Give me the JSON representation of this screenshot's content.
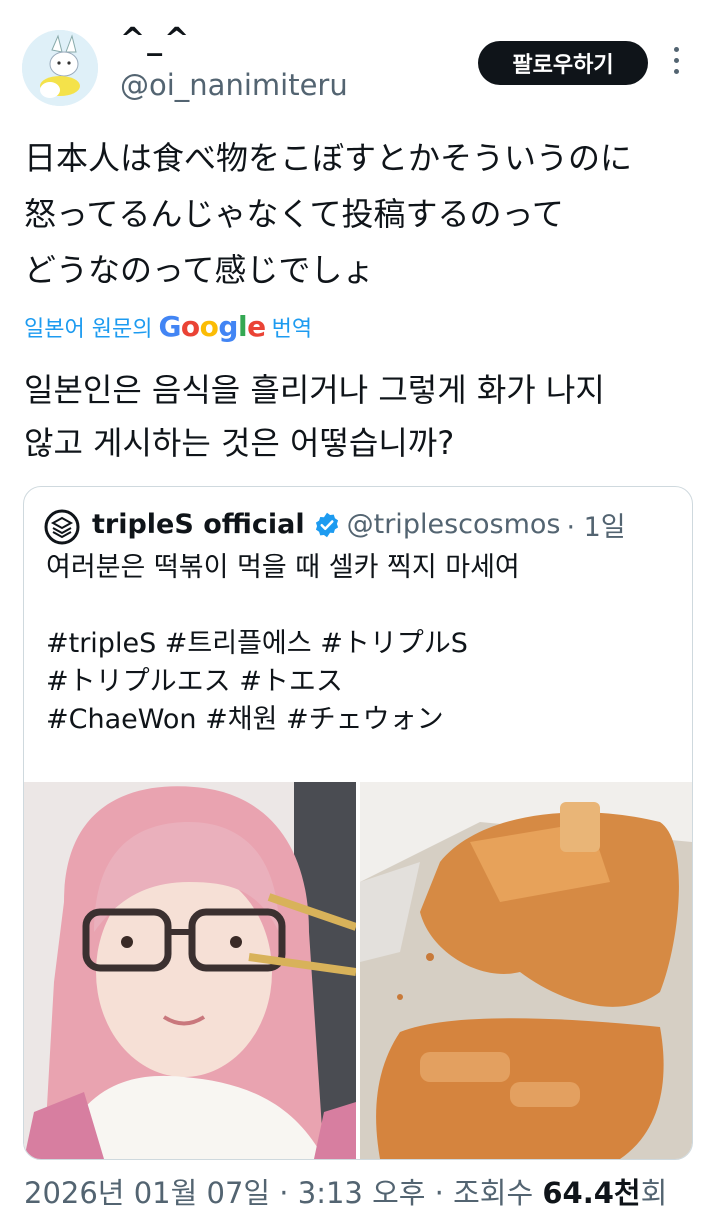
{
  "author": {
    "display_name": "^_^",
    "handle": "@oi_nanimiteru",
    "avatar_icon": "fox-avatar-icon"
  },
  "follow_label": "팔로우하기",
  "more_icon": "more-vertical-icon",
  "tweet_lines": [
    "日本人は食べ物をこぼすとかそういうのに",
    "怒ってるんじゃなくて投稿するのって",
    "どうなのって感じでしょ"
  ],
  "translation": {
    "prefix": "일본어 원문의",
    "google": "Google",
    "suffix": "번역",
    "lines": [
      "일본인은 음식을 흘리거나 그렇게 화가 나지",
      "않고 게시하는 것은 어떻습니까?"
    ]
  },
  "quote": {
    "name": "tripleS official",
    "handle": "@triplescosmos",
    "time": "· 1일",
    "verified_icon": "verified-badge-icon",
    "lines": [
      "여러분은 떡볶이 먹을 때 셀카 찍지 마세여",
      "",
      "#tripleS #트리플에스 #トリプルS",
      "#トリプルエス #トエス",
      "#ChaeWon #채원 #チェウォン"
    ]
  },
  "footer": {
    "date": "2026년 01월 07일 · 3:13 오후 · 조회수",
    "views": "64.4천",
    "views_suffix": "회"
  },
  "colors": {
    "accent": "#1d9bf0",
    "text": "#0f1419",
    "muted": "#536471",
    "button": "#0f1419"
  }
}
